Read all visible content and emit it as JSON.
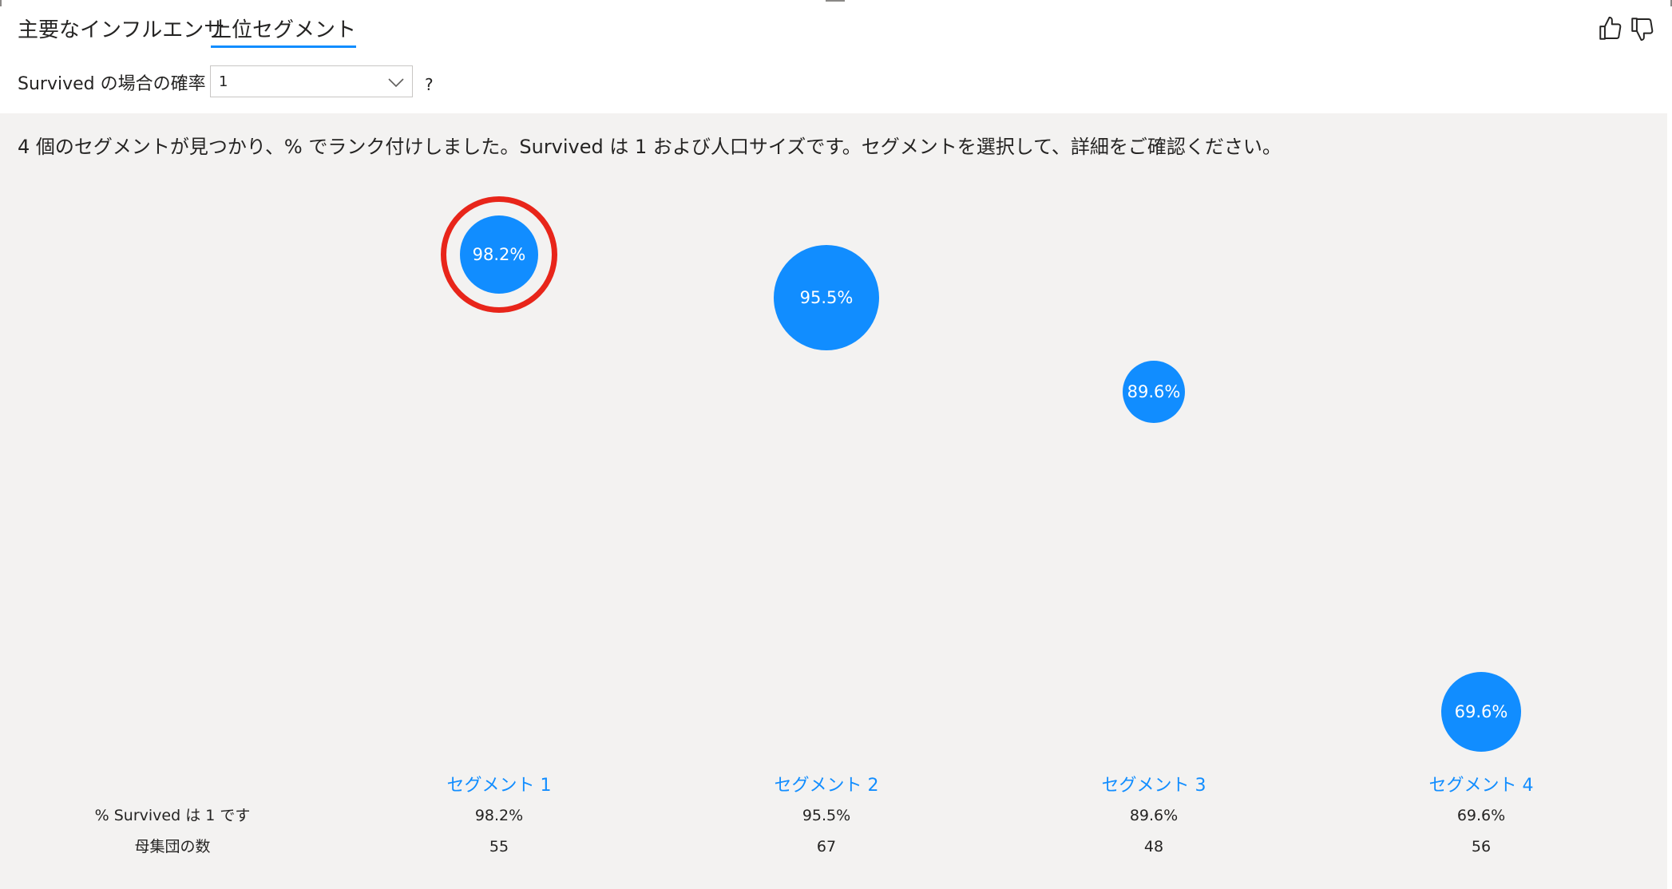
{
  "tabs": [
    {
      "label": "主要なインフルエンサ",
      "active": false
    },
    {
      "label": "上位セグメント",
      "active": true
    }
  ],
  "feedback": {
    "like_icon": "thumbs-up-icon",
    "dislike_icon": "thumbs-down-icon"
  },
  "probability": {
    "label": "Survived の場合の確率",
    "selected": "1",
    "chevron_icon": "chevron-down-icon",
    "help": "?"
  },
  "summary": "4 個のセグメントが見つかり、% でランク付けしました。Survived は 1 および人口サイズです。セグメントを選択して、詳細をご確認ください。",
  "row_labels": {
    "percent": "% Survived は 1 です",
    "population": "母集団の数"
  },
  "colors": {
    "bubble": "#118dff",
    "highlight": "#e8251a",
    "panel": "#f3f2f1"
  },
  "chart_data": {
    "type": "scatter",
    "categories": [
      "セグメント 1",
      "セグメント 2",
      "セグメント 3",
      "セグメント 4"
    ],
    "series": [
      {
        "values": [
          98.2,
          95.5,
          89.6,
          69.6
        ]
      }
    ],
    "bubble_labels": [
      "98.2%",
      "95.5%",
      "89.6%",
      "69.6%"
    ],
    "population": [
      55,
      67,
      48,
      56
    ],
    "highlighted_segment": "セグメント 1"
  },
  "segments": [
    {
      "name": "セグメント 1",
      "percent": "98.2%",
      "population": "55"
    },
    {
      "name": "セグメント 2",
      "percent": "95.5%",
      "population": "67"
    },
    {
      "name": "セグメント 3",
      "percent": "89.6%",
      "population": "48"
    },
    {
      "name": "セグメント 4",
      "percent": "69.6%",
      "population": "56"
    }
  ]
}
